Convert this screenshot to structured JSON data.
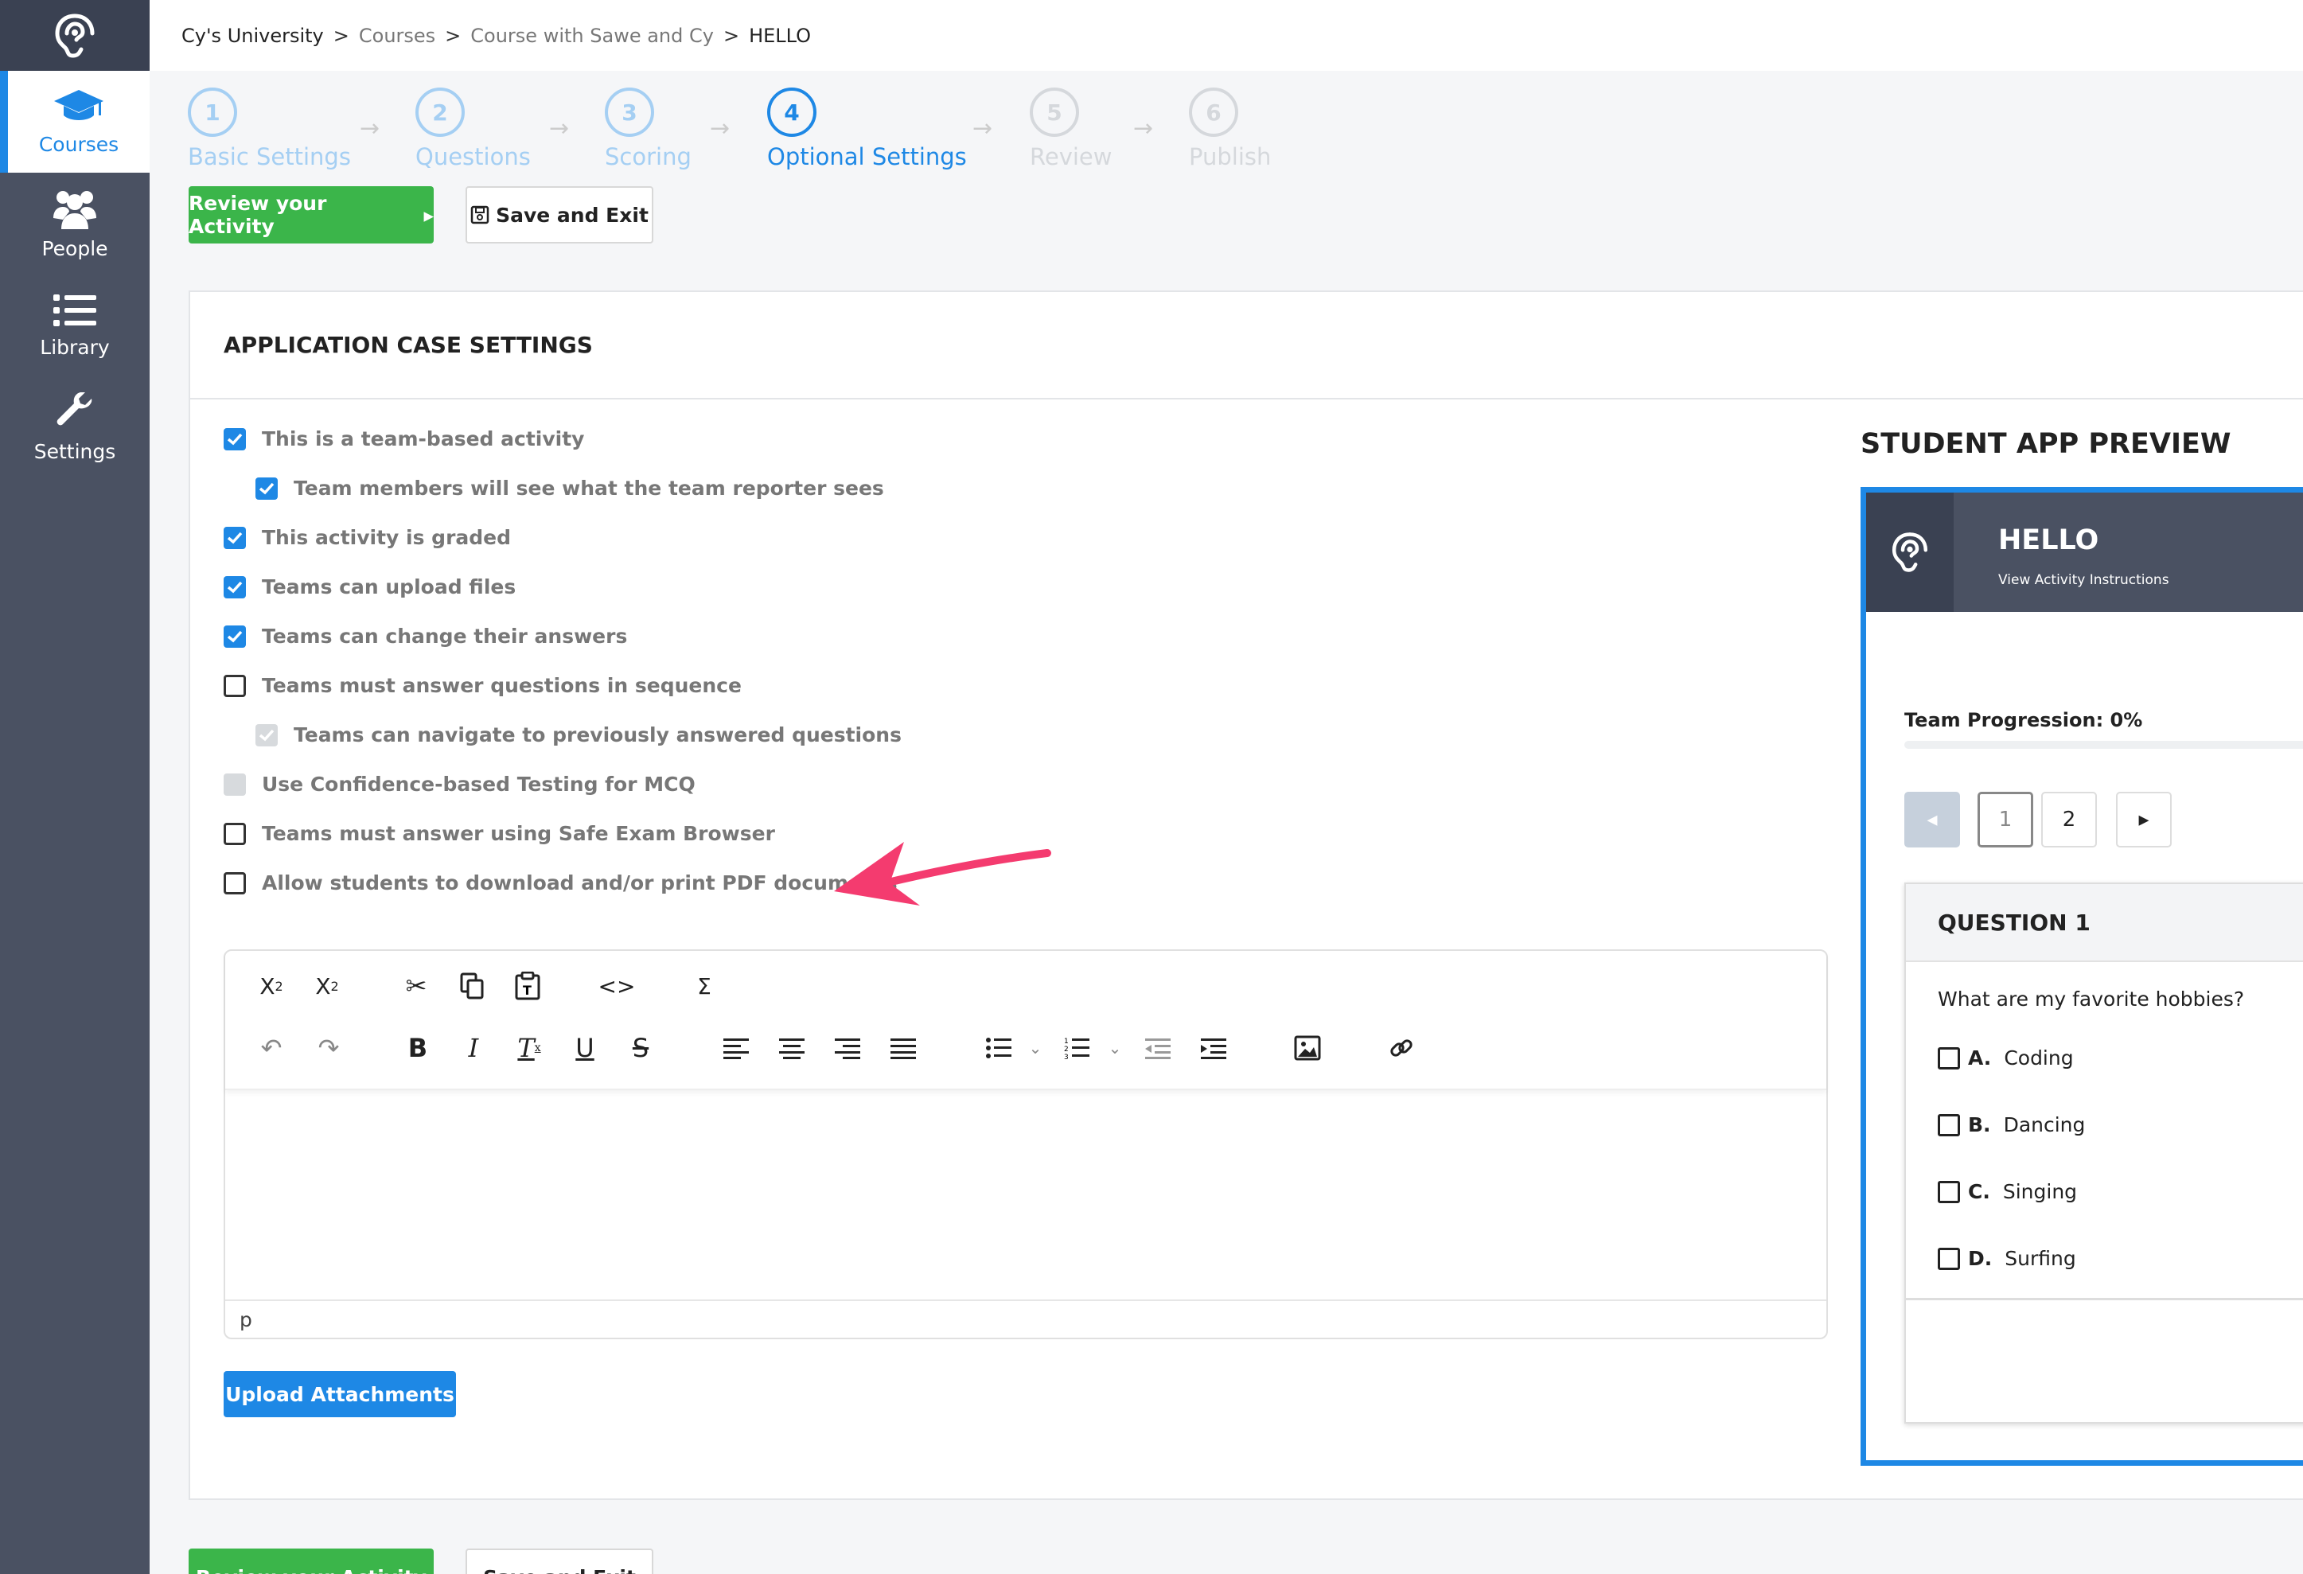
{
  "sidebar": {
    "items": [
      {
        "label": "Courses",
        "icon": "graduation-cap-icon",
        "active": true
      },
      {
        "label": "People",
        "icon": "people-icon",
        "active": false
      },
      {
        "label": "Library",
        "icon": "list-icon",
        "active": false
      },
      {
        "label": "Settings",
        "icon": "wrench-icon",
        "active": false
      }
    ]
  },
  "breadcrumb": {
    "items": [
      "Cy's University",
      "Courses",
      "Course with Sawe and Cy",
      "HELLO"
    ],
    "separator": ">"
  },
  "stepper": {
    "steps": [
      {
        "num": "1",
        "label": "Basic Settings",
        "state": "done"
      },
      {
        "num": "2",
        "label": "Questions",
        "state": "done"
      },
      {
        "num": "3",
        "label": "Scoring",
        "state": "done"
      },
      {
        "num": "4",
        "label": "Optional Settings",
        "state": "active"
      },
      {
        "num": "5",
        "label": "Review",
        "state": "future"
      },
      {
        "num": "6",
        "label": "Publish",
        "state": "future"
      }
    ]
  },
  "actions": {
    "review_label": "Review your Activity",
    "save_exit_label": "Save and Exit"
  },
  "panel": {
    "title": "APPLICATION CASE SETTINGS",
    "options": [
      {
        "label": "This is a team-based activity",
        "state": "checked",
        "indent": false
      },
      {
        "label": "Team members will see what the team reporter sees",
        "state": "checked",
        "indent": true
      },
      {
        "label": "This activity is graded",
        "state": "checked",
        "indent": false
      },
      {
        "label": "Teams can upload files",
        "state": "checked",
        "indent": false
      },
      {
        "label": "Teams can change their answers",
        "state": "checked",
        "indent": false
      },
      {
        "label": "Teams must answer questions in sequence",
        "state": "unchecked",
        "indent": false
      },
      {
        "label": "Teams can navigate to previously answered questions",
        "state": "disabled-checked",
        "indent": true
      },
      {
        "label": "Use Confidence-based Testing for MCQ",
        "state": "disabled",
        "indent": false
      },
      {
        "label": "Teams must answer using Safe Exam Browser",
        "state": "unchecked",
        "indent": false
      },
      {
        "label": "Allow students to download and/or print PDF documents",
        "state": "unchecked",
        "indent": false
      }
    ],
    "editor": {
      "status_path": "p",
      "toolbar_row1": [
        "subscript-icon",
        "superscript-icon",
        "cut-icon",
        "copy-icon",
        "paste-text-icon",
        "code-icon",
        "sigma-icon"
      ],
      "toolbar_row2": [
        "undo-icon",
        "redo-icon",
        "bold-icon",
        "italic-icon",
        "clear-format-icon",
        "underline-icon",
        "strikethrough-icon",
        "align-left-icon",
        "align-center-icon",
        "align-right-icon",
        "align-justify-icon",
        "bullet-list-icon",
        "numbered-list-icon",
        "outdent-icon",
        "indent-icon",
        "image-icon",
        "link-icon"
      ]
    },
    "upload_label": "Upload Attachments"
  },
  "preview": {
    "title": "STUDENT APP PREVIEW",
    "app_title": "HELLO",
    "app_subtitle": "View Activity Instructions",
    "progress_label": "Team Progression: 0%",
    "progress_value": 0,
    "pages": [
      "1",
      "2"
    ],
    "current_page": "1",
    "question": {
      "header": "QUESTION 1",
      "text": "What are my favorite hobbies?",
      "choices": [
        {
          "key": "A.",
          "label": "Coding"
        },
        {
          "key": "B.",
          "label": "Dancing"
        },
        {
          "key": "C.",
          "label": "Singing"
        },
        {
          "key": "D.",
          "label": "Surfing"
        }
      ]
    }
  },
  "colors": {
    "accent": "#1e88e5",
    "green": "#3bb54a",
    "sidebar": "#4a5162",
    "annotation_arrow": "#f43b6f"
  }
}
